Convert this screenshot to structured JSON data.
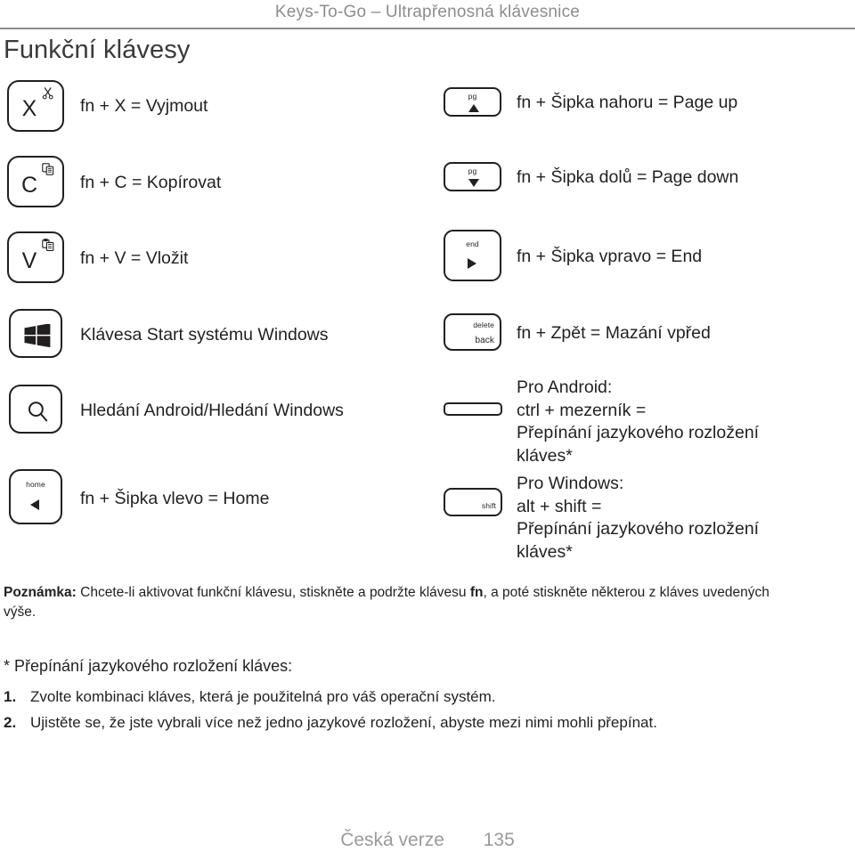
{
  "header": {
    "title": "Keys-To-Go – Ultrapřenosná klávesnice"
  },
  "page_heading": "Funkční klávesy",
  "left_column": [
    {
      "key_label": "X",
      "key_icon": "scissors-icon",
      "description": "fn + X = Vyjmout"
    },
    {
      "key_label": "C",
      "key_icon": "copy-icon",
      "description": "fn + C = Kopírovat"
    },
    {
      "key_label": "V",
      "key_icon": "paste-icon",
      "description": "fn + V = Vložit"
    },
    {
      "key_label": "",
      "key_icon": "windows-logo-icon",
      "description": "Klávesa Start systému Windows"
    },
    {
      "key_label": "",
      "key_icon": "search-icon",
      "description": "Hledání Android/Hledání Windows"
    },
    {
      "key_label": "home",
      "key_icon": "arrow-left-icon",
      "description": "fn + Šipka vlevo = Home"
    }
  ],
  "right_column": [
    {
      "key_top_label": "pg",
      "key_icon": "arrow-up-icon",
      "description": "fn + Šipka nahoru = Page up"
    },
    {
      "key_top_label": "pg",
      "key_icon": "arrow-down-icon",
      "description": "fn + Šipka dolů = Page down"
    },
    {
      "key_top_label": "end",
      "key_icon": "arrow-right-icon",
      "description": "fn + Šipka vpravo = End"
    },
    {
      "key_top_label": "delete",
      "key_bottom_label": "back",
      "key_icon": "delete-back-key",
      "description": "fn + Zpět = Mazání vpřed"
    },
    {
      "key_top_label": "",
      "key_icon": "spacebar-key",
      "description_lines": [
        "Pro Android:",
        "ctrl + mezerník =",
        "Přepínání jazykového rozložení",
        "kláves*"
      ]
    },
    {
      "key_top_label": "shift",
      "key_icon": "shift-key",
      "description_lines": [
        "Pro Windows:",
        "alt + shift =",
        "Přepínání jazykového rozložení",
        "kláves*"
      ]
    }
  ],
  "note": {
    "bold_prefix": "Poznámka:",
    "text_part1": " Chcete-li aktivovat funkční klávesu, stiskněte a podržte klávesu ",
    "bold_inline": "fn",
    "text_part2": ", a poté stiskněte některou z kláves uvedených výše."
  },
  "footnote_heading": "* Přepínání jazykového rozložení kláves:",
  "footnote_items": [
    {
      "num": "1.",
      "text": "Zvolte kombinaci kláves, která je použitelná pro váš operační systém."
    },
    {
      "num": "2.",
      "text": "Ujistěte se, že jste vybrali více než jedno jazykové rozložení, abyste mezi nimi mohli přepínat."
    }
  ],
  "footer": {
    "language": "Česká verze",
    "page_number": "135"
  },
  "colors": {
    "header_gray": "#8d8d8d",
    "body_text": "#231f20",
    "footer_gray": "#9a9a9a"
  }
}
